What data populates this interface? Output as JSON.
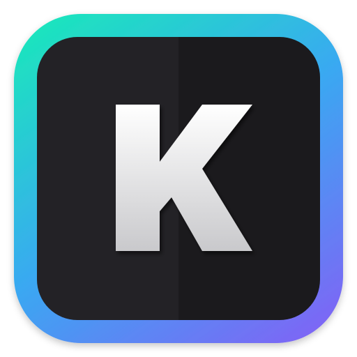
{
  "icon": {
    "name": "k-app-icon",
    "letter": "K",
    "colors": {
      "border_gradient_top": "#1de3bf",
      "border_gradient_mid": "#3aa8f2",
      "border_gradient_bottom": "#7b68f5",
      "face_left": "#232226",
      "face_right": "#1b1a1d",
      "letter_top": "#ffffff",
      "letter_bottom": "#c9c9cc",
      "background": "#ffffff"
    }
  }
}
